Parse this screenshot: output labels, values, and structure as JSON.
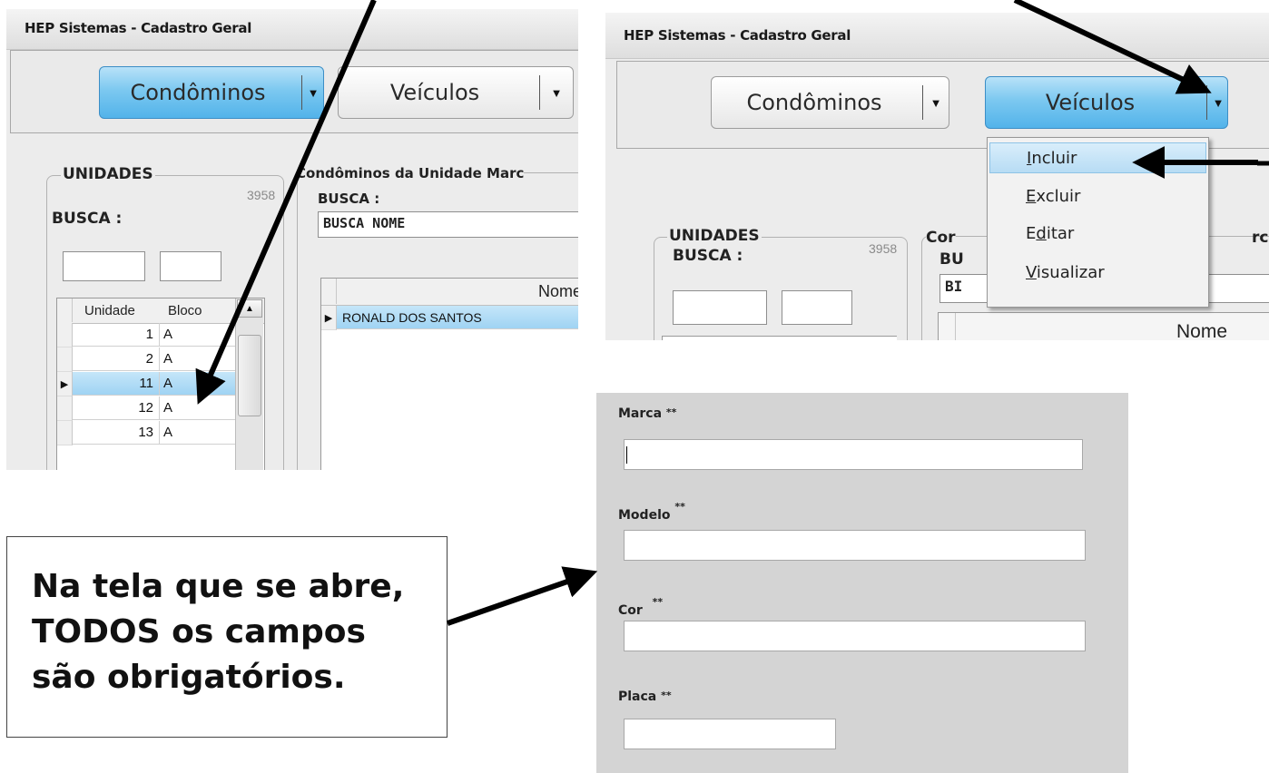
{
  "left_window": {
    "title": "HEP Sistemas - Cadastro Geral",
    "buttons": [
      {
        "label": "Condôminos",
        "active": true
      },
      {
        "label": "Veículos",
        "active": false
      }
    ],
    "unidades": {
      "title": "UNIDADES",
      "count": "3958",
      "busca_label": "BUSCA :",
      "columns": [
        "Unidade",
        "Bloco"
      ],
      "rows": [
        {
          "unidade": "1",
          "bloco": "A",
          "selected": false
        },
        {
          "unidade": "2",
          "bloco": "A",
          "selected": false
        },
        {
          "unidade": "11",
          "bloco": "A",
          "selected": true
        },
        {
          "unidade": "12",
          "bloco": "A",
          "selected": false
        },
        {
          "unidade": "13",
          "bloco": "A",
          "selected": false
        }
      ]
    },
    "condominos": {
      "title": "Condôminos da Unidade Marc",
      "busca_label": "BUSCA :",
      "search_value": "BUSCA NOME",
      "column": "Nome",
      "rows": [
        "RONALD DOS SANTOS"
      ]
    }
  },
  "right_window": {
    "title": "HEP Sistemas - Cadastro Geral",
    "buttons": [
      {
        "label": "Condôminos",
        "active": false
      },
      {
        "label": "Veículos",
        "active": true
      }
    ],
    "unidades_title": "UNIDADES",
    "count": "3958",
    "busca_label": "BUSCA :",
    "cond_title_fragment": "Cor",
    "cond_title_tail": "rc",
    "busca_fragment": "BU",
    "search_fragment": "BI",
    "column": "Nome",
    "menu": [
      {
        "label": "Incluir",
        "access_key": "I",
        "rest": "ncluir",
        "highlighted": true
      },
      {
        "label": "Excluir",
        "access_key": "E",
        "rest": "xcluir",
        "highlighted": false
      },
      {
        "label": "Editar",
        "pre": "E",
        "access_key": "d",
        "rest": "itar",
        "highlighted": false
      },
      {
        "label": "Visualizar",
        "access_key": "V",
        "rest": "isualizar",
        "highlighted": false
      }
    ]
  },
  "form": {
    "fields": [
      {
        "label": "Marca",
        "required": "**"
      },
      {
        "label": "Modelo",
        "required": "**"
      },
      {
        "label": "Cor",
        "required": "**"
      },
      {
        "label": "Placa",
        "required": "**"
      }
    ]
  },
  "callout": {
    "lines": [
      "Na tela que se abre,",
      "TODOS os campos",
      "são obrigatórios."
    ]
  },
  "colors": {
    "active_button": "#52b3ea",
    "selection": "#9fd3f3",
    "form_background": "#d4d4d4"
  }
}
